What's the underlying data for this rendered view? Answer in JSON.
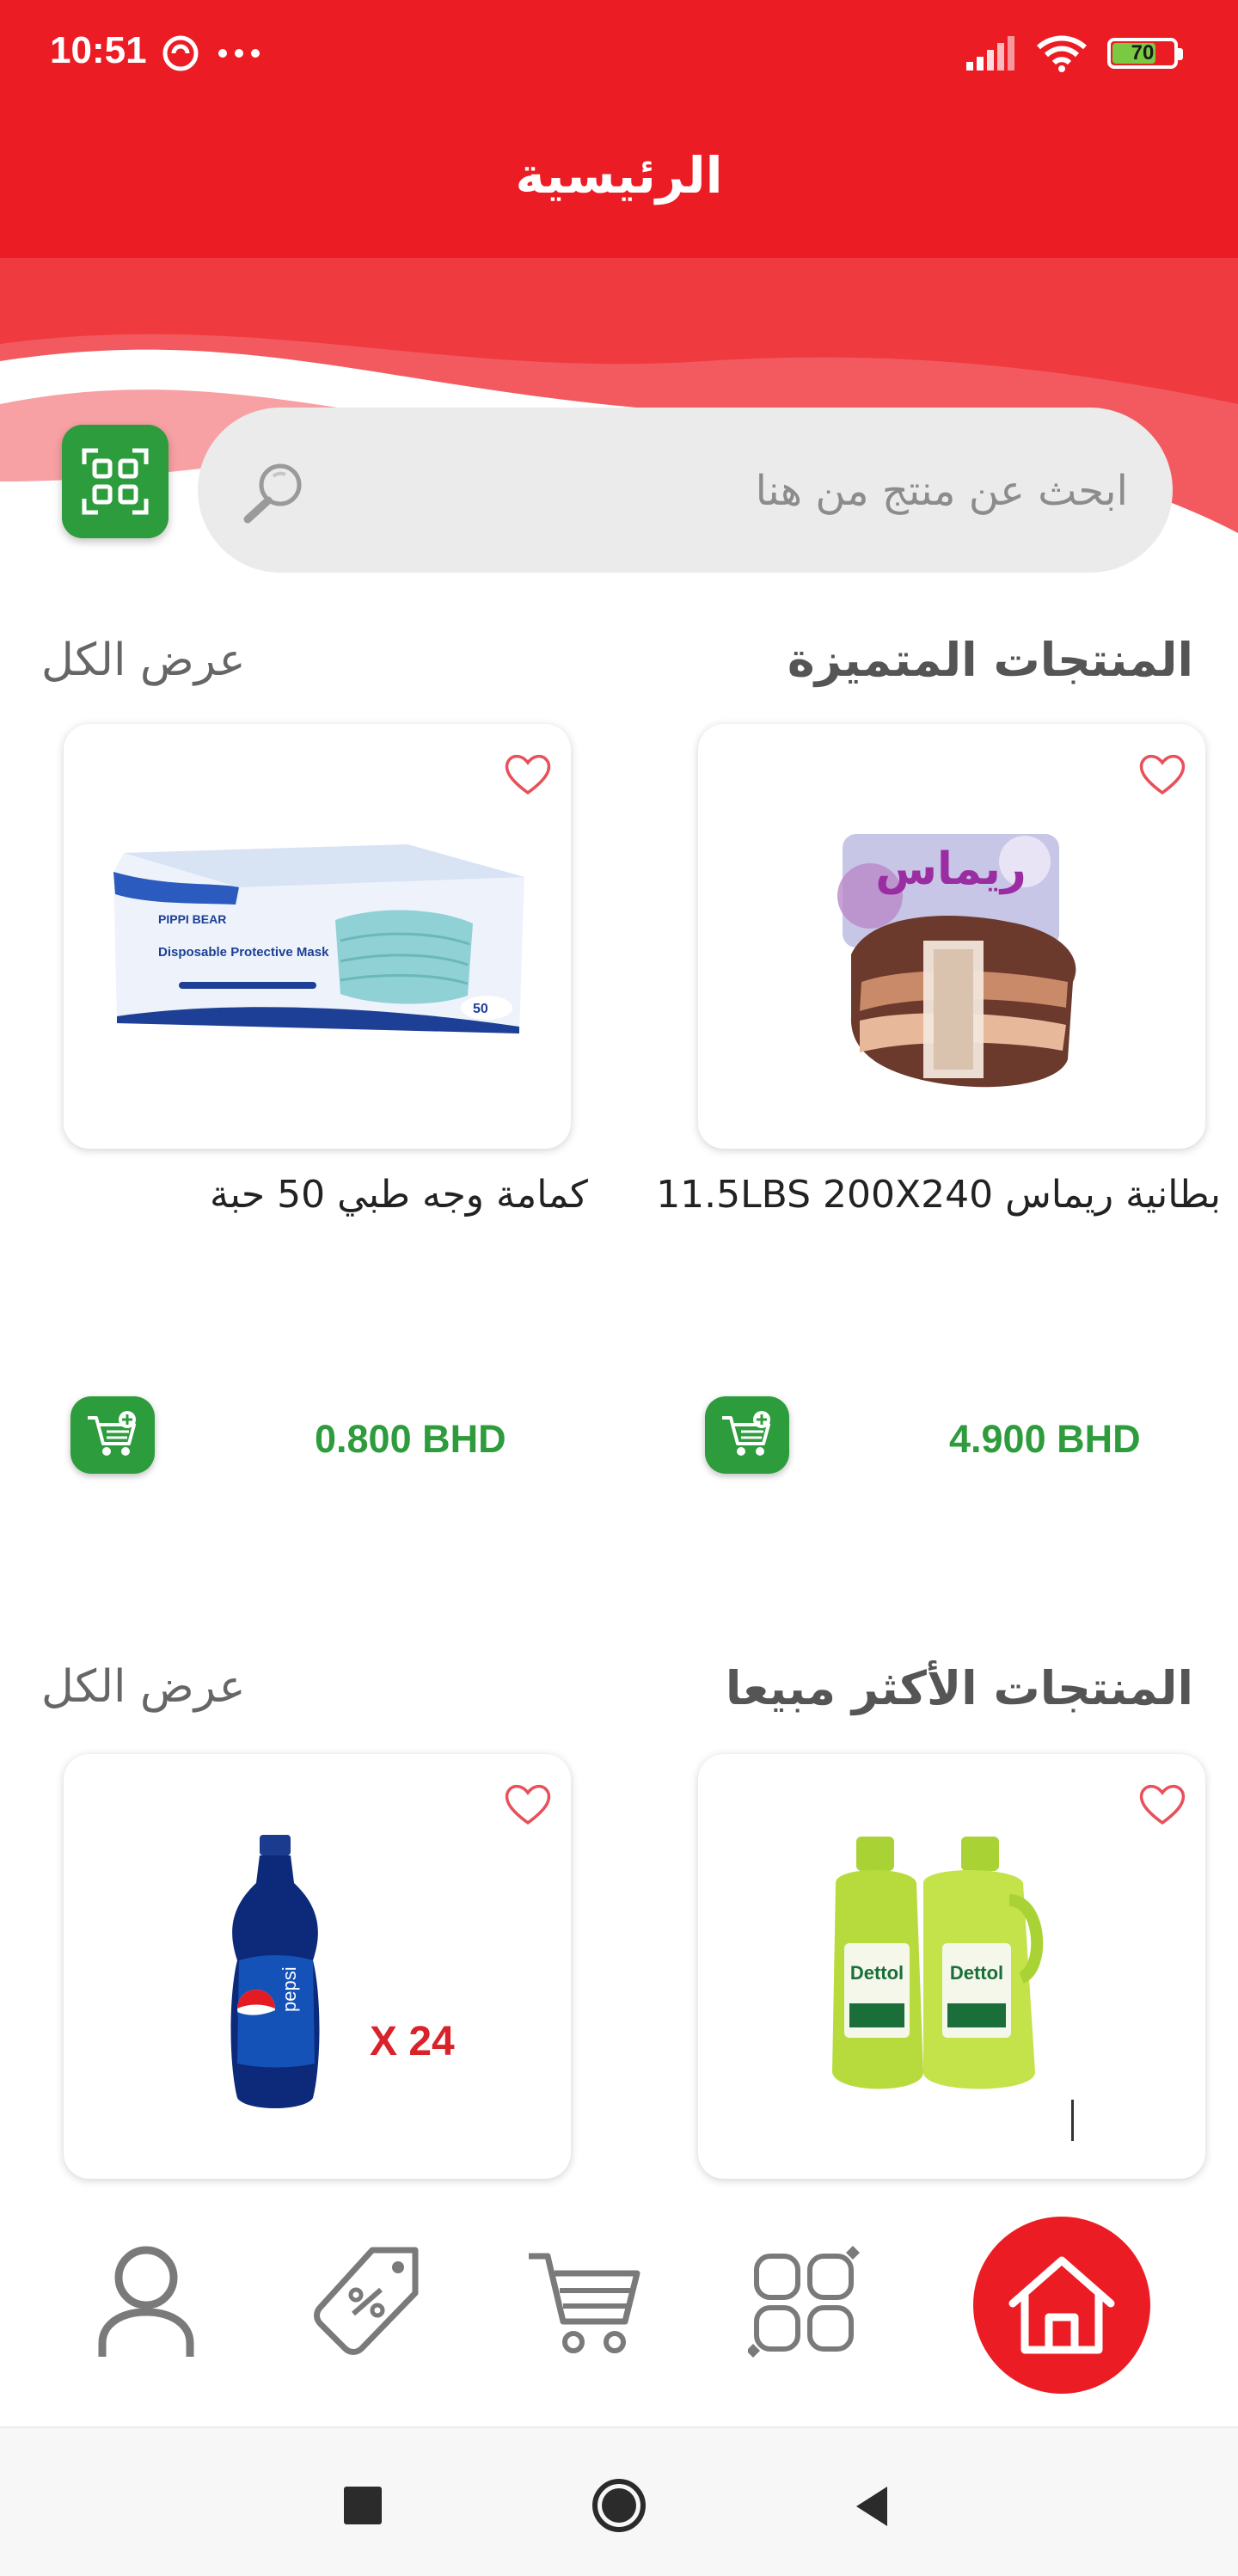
{
  "status_bar": {
    "time": "10:51",
    "battery": "70",
    "battery_level": 0.7
  },
  "header": {
    "title": "الرئيسية"
  },
  "search": {
    "placeholder": "ابحث عن منتج من هنا"
  },
  "featured": {
    "title": "المنتجات المتميزة",
    "view_all": "عرض الكل",
    "products": [
      {
        "name": "بطانية ريماس  11.5LBS  200X240",
        "price": "4.900 BHD",
        "image": "blanket-image"
      },
      {
        "name": "كمامة وجه طبي 50 حبة",
        "price": "0.800 BHD",
        "image": "face-mask-box-image"
      }
    ]
  },
  "best_sellers": {
    "title": "المنتجات الأكثر مبيعا",
    "view_all": "عرض الكل",
    "products": [
      {
        "image": "dettol-cleaner-image",
        "brand_text": "Dettol"
      },
      {
        "image": "pepsi-bottle-image",
        "badge": "X 24",
        "brand_text": "pepsi"
      }
    ]
  },
  "mask_box": {
    "brand": "PIPPI BEAR",
    "label": "Disposable Protective Mask",
    "count": "50"
  },
  "blanket": {
    "brand": "ريماس"
  },
  "nav": {
    "items": [
      "profile-icon",
      "offers-tag-icon",
      "cart-icon",
      "categories-icon",
      "home-icon"
    ],
    "active": "home"
  },
  "colors": {
    "primary_red": "#ec1c24",
    "green": "#2c9c3c",
    "price_green": "#2e9c3d"
  }
}
